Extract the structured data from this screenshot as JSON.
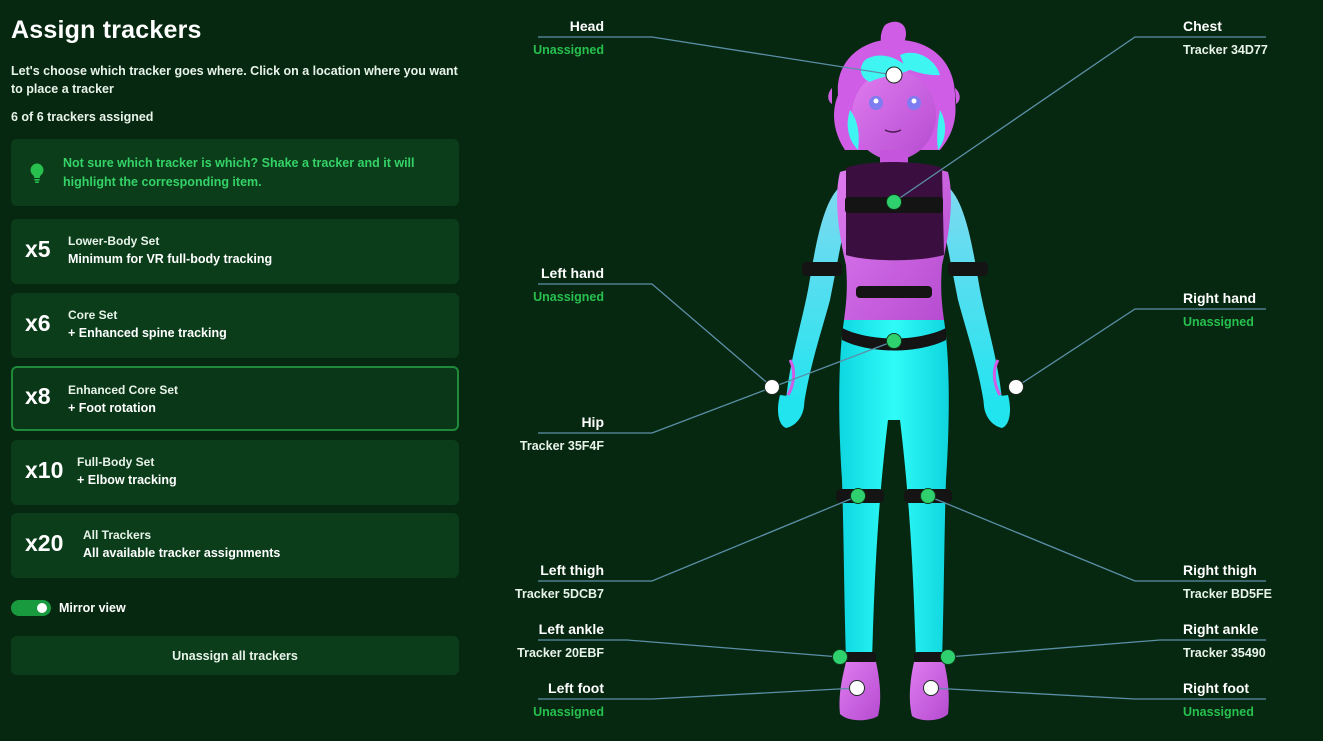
{
  "page": {
    "title": "Assign trackers",
    "intro": "Let's choose which tracker goes where. Click on a location where you want to place a tracker",
    "assigned_count": "6 of 6 trackers assigned",
    "tip": "Not sure which tracker is which? Shake a tracker and it will highlight the corresponding item.",
    "tip_icon": "lightbulb-icon"
  },
  "sets": [
    {
      "mult": "x5",
      "name": "Lower-Body Set",
      "desc": "Minimum for VR full-body tracking",
      "selected": false
    },
    {
      "mult": "x6",
      "name": "Core Set",
      "desc": "+ Enhanced spine tracking",
      "selected": false
    },
    {
      "mult": "x8",
      "name": "Enhanced Core Set",
      "desc": "+ Foot rotation",
      "selected": true
    },
    {
      "mult": "x10",
      "name": "Full-Body Set",
      "desc": "+ Elbow tracking",
      "selected": false
    },
    {
      "mult": "x20",
      "name": "All Trackers",
      "desc": "All available tracker assignments",
      "selected": false
    }
  ],
  "mirror": {
    "label": "Mirror view",
    "on": true
  },
  "unassign_label": "Unassign all trackers",
  "colors": {
    "background": "#072810",
    "card": "#0b3d1a",
    "accent": "#27c04f",
    "assigned_dot": "#2fd16e",
    "unassigned_dot": "#ffffff",
    "leader_line": "#5b8fa8",
    "avatar_body": "#1ff2f0",
    "avatar_skin": "#d46be6"
  },
  "body_parts": {
    "head": {
      "name": "Head",
      "value": "Unassigned",
      "assigned": false
    },
    "chest": {
      "name": "Chest",
      "value": "Tracker 34D77",
      "assigned": true
    },
    "left_hand": {
      "name": "Left hand",
      "value": "Unassigned",
      "assigned": false
    },
    "right_hand": {
      "name": "Right hand",
      "value": "Unassigned",
      "assigned": false
    },
    "hip": {
      "name": "Hip",
      "value": "Tracker 35F4F",
      "assigned": true
    },
    "left_thigh": {
      "name": "Left thigh",
      "value": "Tracker 5DCB7",
      "assigned": true
    },
    "right_thigh": {
      "name": "Right thigh",
      "value": "Tracker BD5FE",
      "assigned": true
    },
    "left_ankle": {
      "name": "Left ankle",
      "value": "Tracker 20EBF",
      "assigned": true
    },
    "right_ankle": {
      "name": "Right ankle",
      "value": "Tracker 35490",
      "assigned": true
    },
    "left_foot": {
      "name": "Left foot",
      "value": "Unassigned",
      "assigned": false
    },
    "right_foot": {
      "name": "Right foot",
      "value": "Unassigned",
      "assigned": false
    }
  }
}
